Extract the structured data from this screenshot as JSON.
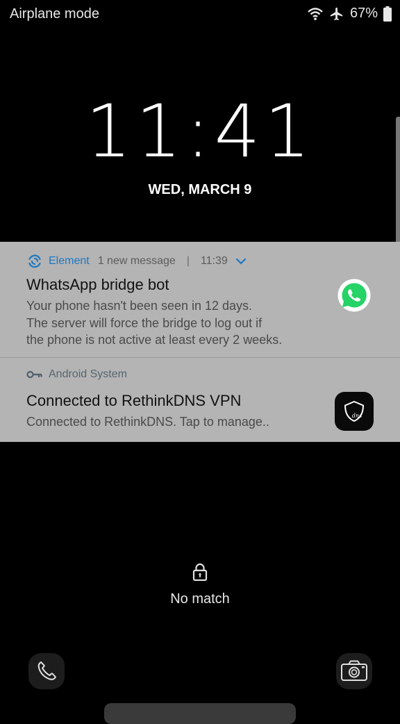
{
  "status_bar": {
    "mode_label": "Airplane mode",
    "battery_percent": "67%",
    "icons": [
      "wifi-icon",
      "airplane-icon",
      "battery-icon"
    ]
  },
  "lockscreen": {
    "time": "11:41",
    "date": "WED, MARCH 9"
  },
  "notifications": [
    {
      "app_name": "Element",
      "summary": "1 new message",
      "separator": "|",
      "time": "11:39",
      "title": "WhatsApp bridge bot",
      "body_lines": [
        "Your phone hasn't been seen in 12 days.",
        "The server will force the bridge to log out if",
        "the phone is not active at least every 2 weeks."
      ],
      "icon": "whatsapp-icon"
    },
    {
      "app_name": "Android System",
      "title": "Connected to RethinkDNS VPN",
      "body_lines": [
        "Connected to RethinkDNS. Tap to manage.."
      ],
      "icon": "rethinkdns-icon",
      "icon_text": "dns"
    }
  ],
  "unlock": {
    "message": "No match"
  },
  "shortcuts": {
    "left": "phone-icon",
    "right": "camera-icon"
  },
  "colors": {
    "notification_bg": "#b4b4b4",
    "element_accent": "#1a78c2",
    "whatsapp_green": "#25d366"
  }
}
